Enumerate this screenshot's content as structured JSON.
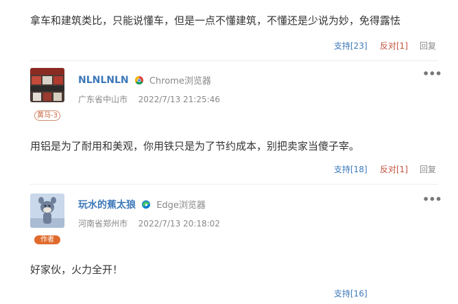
{
  "comments": [
    {
      "text": "拿车和建筑类比，只能说懂车，但是一点不懂建筑，不懂还是少说为妙，免得露怯",
      "support": "支持[23]",
      "oppose": "反对[1]",
      "reply": "回复"
    },
    {
      "username": "NLNLNLN",
      "browser": "Chrome浏览器",
      "location": "广东省中山市",
      "time": "2022/7/13 21:25:46",
      "badge": "黄马-3",
      "more": "•••",
      "text": "用铝是为了耐用和美观，你用铁只是为了节约成本，别把卖家当傻子宰。",
      "support": "支持[18]",
      "oppose": "反对[1]",
      "reply": "回复"
    },
    {
      "username": "玩水的蕉太狼",
      "browser": "Edge浏览器",
      "location": "河南省郑州市",
      "time": "2022/7/13 20:18:02",
      "badge": "作者",
      "more": "•••",
      "text": "好家伙，火力全开！",
      "support": "支持[16]"
    }
  ],
  "icons": {
    "chrome": "chrome-icon",
    "edge": "edge-icon",
    "more": "more-options-icon"
  },
  "colors": {
    "link": "#3c78b9",
    "oppose": "#c2523e",
    "author_badge": "#e06a2c"
  }
}
